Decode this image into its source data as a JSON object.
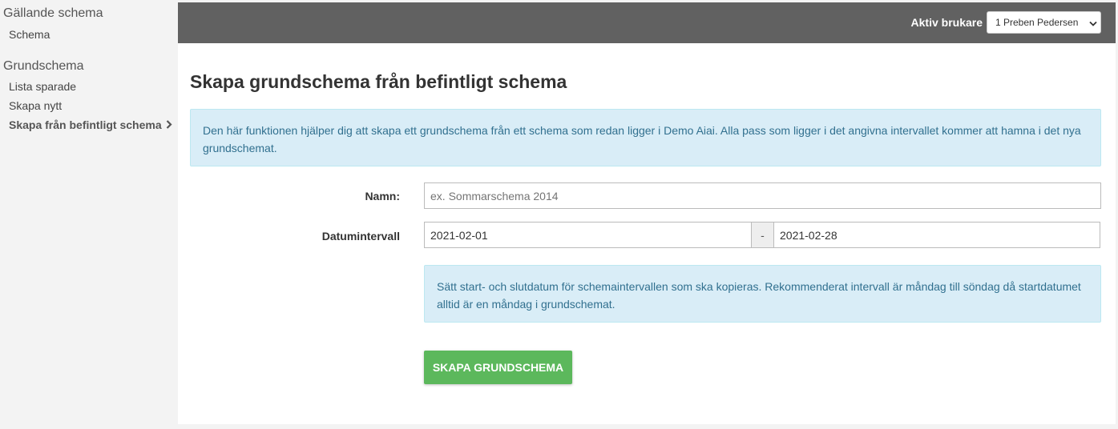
{
  "sidebar": {
    "sections": [
      {
        "title": "Gällande schema",
        "items": [
          {
            "label": "Schema"
          }
        ]
      },
      {
        "title": "Grundschema",
        "items": [
          {
            "label": "Lista sparade"
          },
          {
            "label": "Skapa nytt"
          },
          {
            "label": "Skapa från befintligt schema",
            "active": true
          }
        ]
      }
    ]
  },
  "topbar": {
    "user_label": "Aktiv brukare",
    "user_select": {
      "value": "1 Preben Pedersen"
    }
  },
  "page": {
    "title": "Skapa grundschema från befintligt schema",
    "info": "Den här funktionen hjälper dig att skapa ett grundschema från ett schema som redan ligger i Demo Aiai. Alla pass som ligger i det angivna intervallet kommer att hamna i det nya grundschemat.",
    "form": {
      "name_label": "Namn:",
      "name_placeholder": "ex. Sommarschema 2014",
      "name_value": "",
      "date_label": "Datumintervall",
      "date_start": "2021-02-01",
      "date_separator": "-",
      "date_end": "2021-02-28",
      "date_help": "Sätt start- och slutdatum för schemaintervallen som ska kopieras. Rekommenderat intervall är måndag till söndag då startdatumet alltid är en måndag i grundschemat.",
      "submit_label": "SKAPA GRUNDSCHEMA"
    }
  },
  "colors": {
    "topbar": "#616161",
    "info_bg": "#d9edf7",
    "info_text": "#31708f",
    "button": "#5cb85c"
  }
}
